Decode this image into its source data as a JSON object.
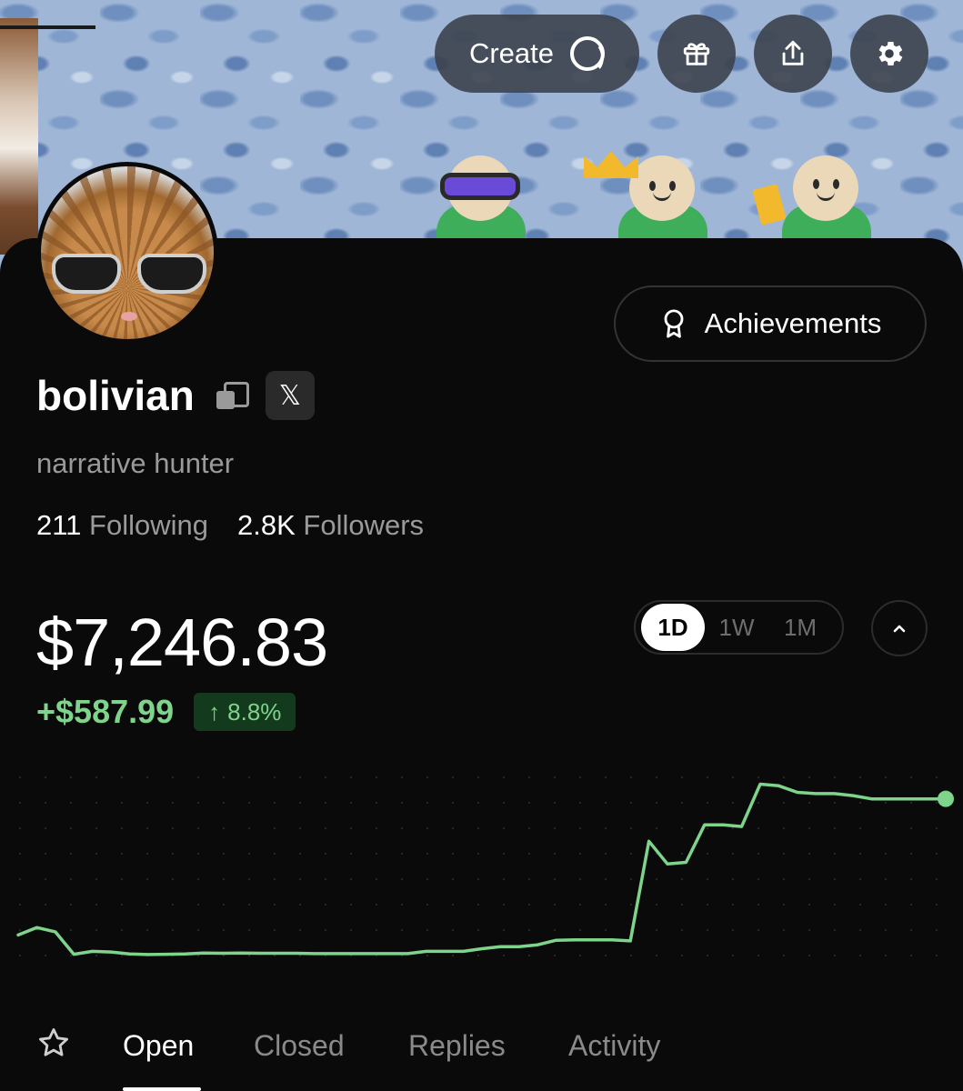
{
  "header": {
    "create_label": "Create",
    "icons": [
      "create-coin-icon",
      "gift-icon",
      "share-icon",
      "gear-icon"
    ]
  },
  "profile": {
    "username": "bolivian",
    "x_badge": "𝕏",
    "bio": "narrative hunter",
    "following_count": "211",
    "following_label": "Following",
    "followers_count": "2.8K",
    "followers_label": "Followers",
    "achievements_label": "Achievements"
  },
  "portfolio": {
    "balance": "$7,246.83",
    "change_amount": "+$587.99",
    "change_percent": "8.8%",
    "change_arrow": "↑",
    "ranges": [
      "1D",
      "1W",
      "1M"
    ],
    "selected_range": "1D",
    "accent_color": "#7ed48b"
  },
  "chart_data": {
    "type": "line",
    "title": "",
    "x": [
      0,
      1,
      2,
      3,
      4,
      5,
      6,
      7,
      8,
      9,
      10,
      11,
      12,
      13,
      14,
      15,
      16,
      17,
      18,
      19,
      20,
      21,
      22,
      23,
      24,
      25,
      26,
      27,
      28,
      29,
      30,
      31,
      32,
      33,
      34,
      35,
      36,
      37,
      38,
      39,
      40,
      41,
      42,
      43,
      44,
      45,
      46,
      47,
      48,
      49,
      50
    ],
    "values": [
      6752,
      6775,
      6762,
      6693,
      6702,
      6700,
      6694,
      6692,
      6693,
      6694,
      6697,
      6696,
      6697,
      6696,
      6696,
      6696,
      6695,
      6695,
      6695,
      6695,
      6695,
      6695,
      6702,
      6702,
      6702,
      6710,
      6716,
      6716,
      6722,
      6736,
      6737,
      6737,
      6737,
      6734,
      7040,
      6970,
      6975,
      7090,
      7090,
      7085,
      7215,
      7210,
      7190,
      7186,
      7186,
      7180,
      7170,
      7170,
      7170,
      7170,
      7170
    ],
    "ylim": [
      6650,
      7250
    ],
    "grid": true,
    "color": "#7ed48b"
  },
  "tabs": {
    "items": [
      "Open",
      "Closed",
      "Replies",
      "Activity"
    ],
    "active": "Open"
  }
}
